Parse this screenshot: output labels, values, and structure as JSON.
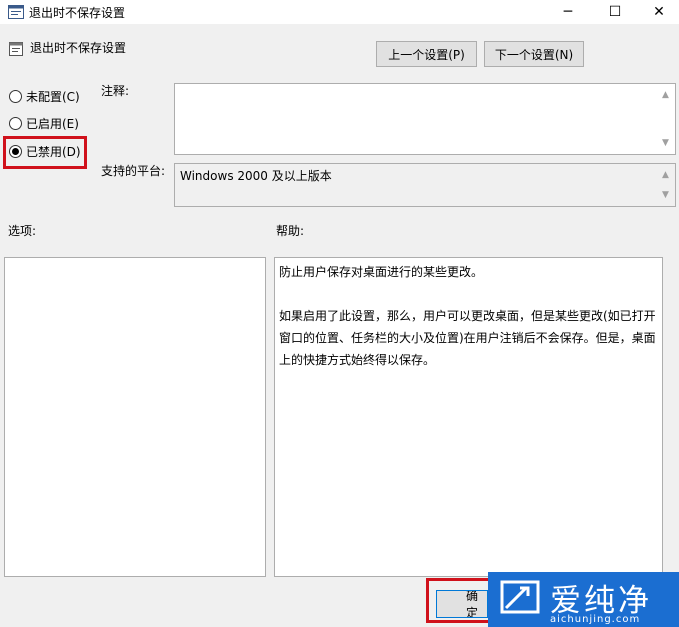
{
  "window": {
    "title": "退出时不保存设置",
    "controls": {
      "minimize": "─",
      "maximize": "☐",
      "close": "✕"
    }
  },
  "header": {
    "setting_name": "退出时不保存设置",
    "prev_button": "上一个设置(P)",
    "next_button": "下一个设置(N)"
  },
  "state": {
    "options": [
      {
        "label": "未配置(C)",
        "selected": false
      },
      {
        "label": "已启用(E)",
        "selected": false
      },
      {
        "label": "已禁用(D)",
        "selected": true
      }
    ]
  },
  "fields": {
    "comment_label": "注释:",
    "comment_value": "",
    "platform_label": "支持的平台:",
    "platform_value": "Windows 2000 及以上版本"
  },
  "sections": {
    "options_label": "选项:",
    "help_label": "帮助:",
    "help_text": [
      "防止用户保存对桌面进行的某些更改。",
      "",
      "如果启用了此设置，那么，用户可以更改桌面，但是某些更改(如已打开窗口的位置、任务栏的大小及位置)在用户注销后不会保存。但是，桌面上的快捷方式始终得以保存。"
    ]
  },
  "footer": {
    "ok_button": "确定"
  },
  "watermark": {
    "title": "爱纯净",
    "url": "aichunjing.com"
  },
  "colors": {
    "highlight": "#d0111b",
    "watermark_bg": "#1b6ed1",
    "focus_border": "#0078d7"
  }
}
